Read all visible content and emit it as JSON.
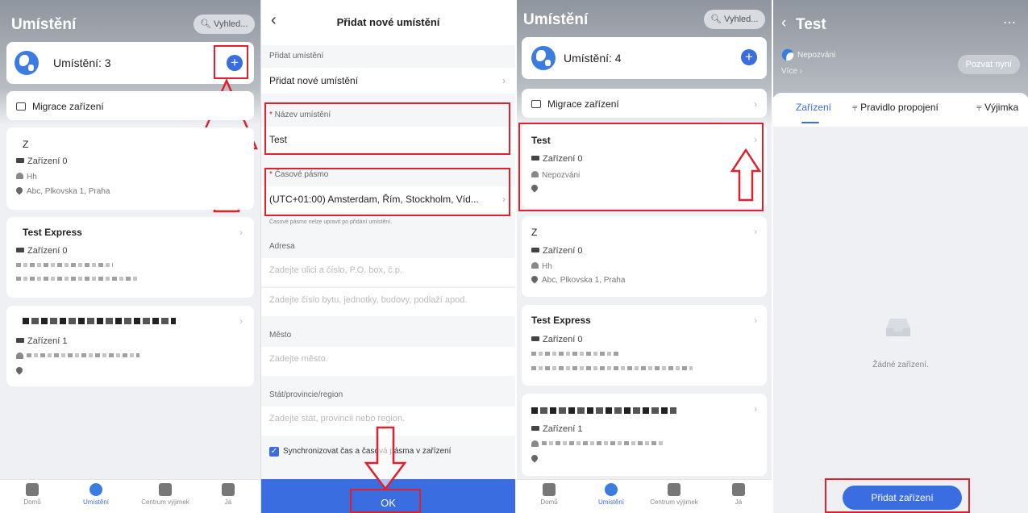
{
  "screen1": {
    "title": "Umístění",
    "search_placeholder": "Vyhled...",
    "locations_count_label": "Umístění: 3",
    "migrate_label": "Migrace zařízení",
    "cards": [
      {
        "title": "Z",
        "devices": "Zařízení 0",
        "owner": "Hh",
        "address": "Abc, Plkovska 1, Praha"
      },
      {
        "title": "Test Express",
        "devices": "Zařízení 0"
      },
      {
        "devices": "Zařízení 1"
      }
    ]
  },
  "screen2": {
    "title": "Přidat nové umístění",
    "section_add": "Přidat umístění",
    "add_new_label": "Přidat nové umístění",
    "name_label": "Název umístění",
    "name_value": "Test",
    "timezone_label": "Časové pásmo",
    "timezone_value": "(UTC+01:00) Amsterdam, Řím, Stockholm, Víd...",
    "timezone_note": "Časové pásmo nelze upravit po přidání umístění.",
    "address_label": "Adresa",
    "street_placeholder": "Zadejte ulici a číslo, P.O. box, č.p.",
    "unit_placeholder": "Zadejte číslo bytu, jednotky, budovy, podlaží apod.",
    "city_label": "Město",
    "city_placeholder": "Zadejte město.",
    "state_label": "Stát/provincie/region",
    "state_placeholder": "Zadejte stát, provincii nebo region.",
    "sync_label": "Synchronizovat čas a časová pásma v zařízení",
    "sync_checked": true,
    "ok_label": "OK"
  },
  "screen3": {
    "title": "Umístění",
    "search_placeholder": "Vyhled...",
    "locations_count_label": "Umístění: 4",
    "migrate_label": "Migrace zařízení",
    "cards": [
      {
        "title": "Test",
        "devices": "Zařízení 0",
        "owner": "Nepozváni"
      },
      {
        "title": "Z",
        "devices": "Zařízení 0",
        "owner": "Hh",
        "address": "Abc, Plkovska 1, Praha"
      },
      {
        "title": "Test Express",
        "devices": "Zařízení 0"
      },
      {
        "devices": "Zařízení 1"
      }
    ]
  },
  "screen4": {
    "title": "Test",
    "more_icon": "more-horizontal-icon",
    "status": "Nepozváni",
    "more_label": "Více",
    "invite_label": "Pozvat nyní",
    "tabs": [
      "Zařízení",
      "Pravidlo propojení",
      "Výjimka"
    ],
    "empty_text": "Žádné zařízení.",
    "add_device_label": "Přidat zařízení"
  },
  "bottom_nav": [
    "Domů",
    "Umístění",
    "Centrum výjimek",
    "Já"
  ],
  "colors": {
    "accent": "#3a6de0",
    "highlight": "#e0202c",
    "header_gray": "#8f959e"
  }
}
